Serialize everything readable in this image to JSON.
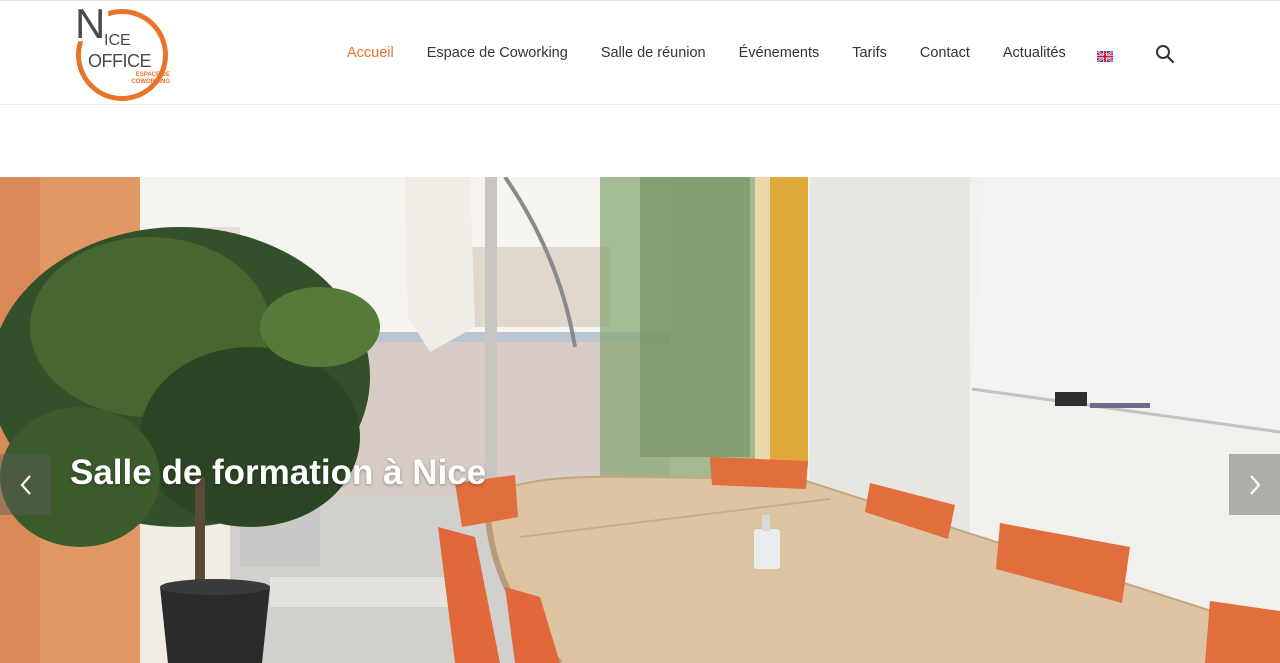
{
  "logo": {
    "letter_n": "N",
    "ice": "ICE",
    "office": "OFFICE",
    "subtitle": "ESPACE DE COWORKING"
  },
  "nav": {
    "items": [
      {
        "label": "Accueil",
        "active": true
      },
      {
        "label": "Espace de Coworking",
        "active": false
      },
      {
        "label": "Salle de réunion",
        "active": false
      },
      {
        "label": "Événements",
        "active": false
      },
      {
        "label": "Tarifs",
        "active": false
      },
      {
        "label": "Contact",
        "active": false
      },
      {
        "label": "Actualités",
        "active": false
      }
    ],
    "language_flag_icon": "uk-flag-icon",
    "search_icon": "search-icon"
  },
  "hero": {
    "title": "Salle de formation à Nice",
    "prev_icon": "chevron-left-icon",
    "next_icon": "chevron-right-icon"
  },
  "colors": {
    "accent": "#e8742a",
    "text": "#333333"
  }
}
